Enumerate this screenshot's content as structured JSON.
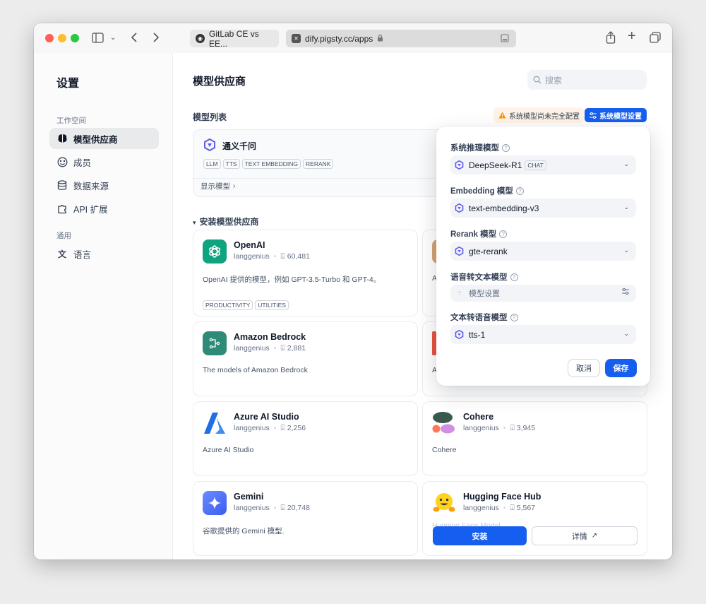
{
  "browser": {
    "tabs": [
      {
        "label": "GitLab CE vs EE..."
      },
      {
        "label": "dify.pigsty.cc/apps"
      }
    ]
  },
  "sidebar": {
    "title": "设置",
    "sections": [
      {
        "label": "工作空间"
      },
      {
        "label": "通用"
      }
    ],
    "items": [
      {
        "label": "模型供应商",
        "icon": "brain-icon",
        "active": true
      },
      {
        "label": "成员",
        "icon": "members-icon"
      },
      {
        "label": "数据来源",
        "icon": "database-icon"
      },
      {
        "label": "API 扩展",
        "icon": "puzzle-icon"
      },
      {
        "label": "语言",
        "icon": "translate-icon"
      }
    ]
  },
  "main": {
    "title": "模型供应商",
    "search_placeholder": "搜索",
    "model_list_label": "模型列表",
    "warning_text": "系统模型尚未完全配置",
    "system_settings_button": "系统模型设置",
    "configured_provider": {
      "name": "通义千问",
      "tags": [
        "LLM",
        "TTS",
        "TEXT EMBEDDING",
        "RERANK"
      ],
      "show_models_label": "显示模型"
    },
    "install_section_title": "安装模型供应商",
    "providers": [
      {
        "name": "OpenAI",
        "author": "langgenius",
        "installs": "60,481",
        "description": "OpenAI 提供的模型，例如 GPT-3.5-Turbo 和 GPT-4。",
        "tags": [
          "PRODUCTIVITY",
          "UTILITIES"
        ],
        "color": "#10a37f"
      },
      {
        "name": "Amazon Bedrock",
        "author": "langgenius",
        "installs": "2,881",
        "description": "The models of Amazon Bedrock",
        "color": "#2e8b78"
      },
      {
        "name": "Azure AI Studio",
        "author": "langgenius",
        "installs": "2,256",
        "description": "Azure AI Studio",
        "color": "#1f6fe5"
      },
      {
        "name": "Cohere",
        "author": "langgenius",
        "installs": "3,945",
        "description": "Cohere",
        "color": "#39594d"
      },
      {
        "name": "Gemini",
        "author": "langgenius",
        "installs": "20,748",
        "description": "谷歌提供的 Gemini 模型.",
        "color": "#4f7dfa"
      },
      {
        "name": "Hugging Face Hub",
        "author": "langgenius",
        "installs": "5,567",
        "description": "Hugging Face Model",
        "color": "#ffd21e"
      }
    ],
    "partial_left_descs": [
      "A",
      "A"
    ],
    "install_button": "安装",
    "detail_button": "详情"
  },
  "popup": {
    "fields": [
      {
        "label": "系统推理模型",
        "value": "DeepSeek-R1",
        "tag": "CHAT"
      },
      {
        "label": "Embedding 模型",
        "value": "text-embedding-v3"
      },
      {
        "label": "Rerank 模型",
        "value": "gte-rerank"
      },
      {
        "label": "语音转文本模型",
        "value": "模型设置"
      },
      {
        "label": "文本转语音模型",
        "value": "tts-1"
      }
    ],
    "help_glyph": "?",
    "cancel": "取消",
    "save": "保存"
  }
}
